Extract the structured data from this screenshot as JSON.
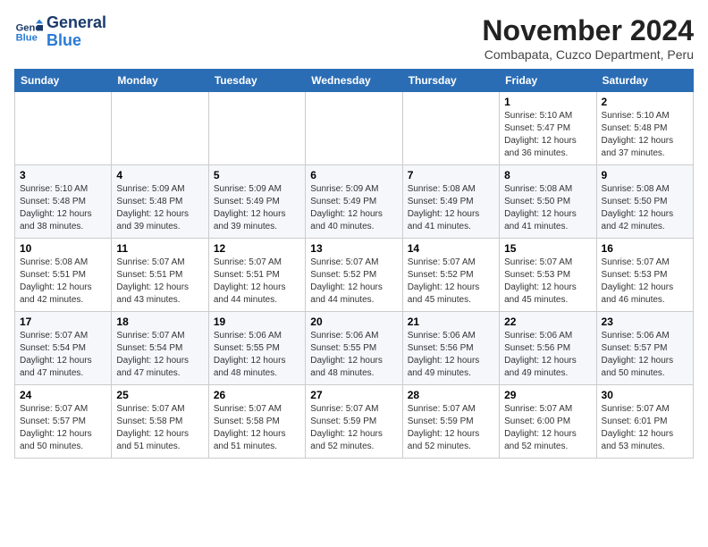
{
  "header": {
    "logo_line1": "General",
    "logo_line2": "Blue",
    "month_title": "November 2024",
    "location": "Combapata, Cuzco Department, Peru"
  },
  "weekdays": [
    "Sunday",
    "Monday",
    "Tuesday",
    "Wednesday",
    "Thursday",
    "Friday",
    "Saturday"
  ],
  "weeks": [
    [
      {
        "day": "",
        "info": ""
      },
      {
        "day": "",
        "info": ""
      },
      {
        "day": "",
        "info": ""
      },
      {
        "day": "",
        "info": ""
      },
      {
        "day": "",
        "info": ""
      },
      {
        "day": "1",
        "info": "Sunrise: 5:10 AM\nSunset: 5:47 PM\nDaylight: 12 hours\nand 36 minutes."
      },
      {
        "day": "2",
        "info": "Sunrise: 5:10 AM\nSunset: 5:48 PM\nDaylight: 12 hours\nand 37 minutes."
      }
    ],
    [
      {
        "day": "3",
        "info": "Sunrise: 5:10 AM\nSunset: 5:48 PM\nDaylight: 12 hours\nand 38 minutes."
      },
      {
        "day": "4",
        "info": "Sunrise: 5:09 AM\nSunset: 5:48 PM\nDaylight: 12 hours\nand 39 minutes."
      },
      {
        "day": "5",
        "info": "Sunrise: 5:09 AM\nSunset: 5:49 PM\nDaylight: 12 hours\nand 39 minutes."
      },
      {
        "day": "6",
        "info": "Sunrise: 5:09 AM\nSunset: 5:49 PM\nDaylight: 12 hours\nand 40 minutes."
      },
      {
        "day": "7",
        "info": "Sunrise: 5:08 AM\nSunset: 5:49 PM\nDaylight: 12 hours\nand 41 minutes."
      },
      {
        "day": "8",
        "info": "Sunrise: 5:08 AM\nSunset: 5:50 PM\nDaylight: 12 hours\nand 41 minutes."
      },
      {
        "day": "9",
        "info": "Sunrise: 5:08 AM\nSunset: 5:50 PM\nDaylight: 12 hours\nand 42 minutes."
      }
    ],
    [
      {
        "day": "10",
        "info": "Sunrise: 5:08 AM\nSunset: 5:51 PM\nDaylight: 12 hours\nand 42 minutes."
      },
      {
        "day": "11",
        "info": "Sunrise: 5:07 AM\nSunset: 5:51 PM\nDaylight: 12 hours\nand 43 minutes."
      },
      {
        "day": "12",
        "info": "Sunrise: 5:07 AM\nSunset: 5:51 PM\nDaylight: 12 hours\nand 44 minutes."
      },
      {
        "day": "13",
        "info": "Sunrise: 5:07 AM\nSunset: 5:52 PM\nDaylight: 12 hours\nand 44 minutes."
      },
      {
        "day": "14",
        "info": "Sunrise: 5:07 AM\nSunset: 5:52 PM\nDaylight: 12 hours\nand 45 minutes."
      },
      {
        "day": "15",
        "info": "Sunrise: 5:07 AM\nSunset: 5:53 PM\nDaylight: 12 hours\nand 45 minutes."
      },
      {
        "day": "16",
        "info": "Sunrise: 5:07 AM\nSunset: 5:53 PM\nDaylight: 12 hours\nand 46 minutes."
      }
    ],
    [
      {
        "day": "17",
        "info": "Sunrise: 5:07 AM\nSunset: 5:54 PM\nDaylight: 12 hours\nand 47 minutes."
      },
      {
        "day": "18",
        "info": "Sunrise: 5:07 AM\nSunset: 5:54 PM\nDaylight: 12 hours\nand 47 minutes."
      },
      {
        "day": "19",
        "info": "Sunrise: 5:06 AM\nSunset: 5:55 PM\nDaylight: 12 hours\nand 48 minutes."
      },
      {
        "day": "20",
        "info": "Sunrise: 5:06 AM\nSunset: 5:55 PM\nDaylight: 12 hours\nand 48 minutes."
      },
      {
        "day": "21",
        "info": "Sunrise: 5:06 AM\nSunset: 5:56 PM\nDaylight: 12 hours\nand 49 minutes."
      },
      {
        "day": "22",
        "info": "Sunrise: 5:06 AM\nSunset: 5:56 PM\nDaylight: 12 hours\nand 49 minutes."
      },
      {
        "day": "23",
        "info": "Sunrise: 5:06 AM\nSunset: 5:57 PM\nDaylight: 12 hours\nand 50 minutes."
      }
    ],
    [
      {
        "day": "24",
        "info": "Sunrise: 5:07 AM\nSunset: 5:57 PM\nDaylight: 12 hours\nand 50 minutes."
      },
      {
        "day": "25",
        "info": "Sunrise: 5:07 AM\nSunset: 5:58 PM\nDaylight: 12 hours\nand 51 minutes."
      },
      {
        "day": "26",
        "info": "Sunrise: 5:07 AM\nSunset: 5:58 PM\nDaylight: 12 hours\nand 51 minutes."
      },
      {
        "day": "27",
        "info": "Sunrise: 5:07 AM\nSunset: 5:59 PM\nDaylight: 12 hours\nand 52 minutes."
      },
      {
        "day": "28",
        "info": "Sunrise: 5:07 AM\nSunset: 5:59 PM\nDaylight: 12 hours\nand 52 minutes."
      },
      {
        "day": "29",
        "info": "Sunrise: 5:07 AM\nSunset: 6:00 PM\nDaylight: 12 hours\nand 52 minutes."
      },
      {
        "day": "30",
        "info": "Sunrise: 5:07 AM\nSunset: 6:01 PM\nDaylight: 12 hours\nand 53 minutes."
      }
    ]
  ]
}
